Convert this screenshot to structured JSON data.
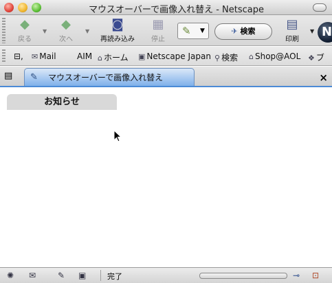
{
  "window": {
    "title": "マウスオーバーで画像入れ替え - Netscape"
  },
  "toolbar": {
    "back_label": "戻る",
    "forward_label": "次へ",
    "reload_label": "再読み込み",
    "stop_label": "停止",
    "search_label": "検索",
    "print_label": "印刷"
  },
  "personal_toolbar": {
    "items": [
      {
        "label": "Mail",
        "icon": "mail-icon"
      },
      {
        "label": "AIM",
        "icon": "aim-icon"
      },
      {
        "label": "ホーム",
        "icon": "home-icon"
      },
      {
        "label": "Netscape Japan",
        "icon": "netscape-icon"
      },
      {
        "label": "検索",
        "icon": "search-icon"
      },
      {
        "label": "Shop@AOL",
        "icon": "shop-icon"
      },
      {
        "label": "ブ",
        "icon": "bookmark-icon"
      }
    ]
  },
  "tabs": [
    {
      "title": "マウスオーバーで画像入れ替え",
      "active": true
    }
  ],
  "content": {
    "notice_tab_label": "お知らせ"
  },
  "statusbar": {
    "status_text": "完了"
  },
  "colors": {
    "tab_accent": "#4a8ad6",
    "notice_bg": "#d9d9d9"
  }
}
